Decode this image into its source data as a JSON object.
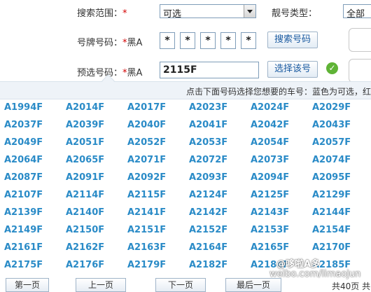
{
  "search": {
    "range_label": "搜索范围：",
    "required_mark": "*",
    "range_value": "可选",
    "type_label": "靓号类型：",
    "type_value": "全部"
  },
  "plate": {
    "label": "号牌号码：",
    "required_mark": "*",
    "prefix": "黑A",
    "chars": [
      "*",
      "*",
      "*",
      "*",
      "*"
    ],
    "search_button": "搜索号码"
  },
  "preselect": {
    "label": "预选号码：",
    "required_mark": "*",
    "prefix": "黑A",
    "value": "2115F",
    "select_button": "选择该号"
  },
  "hint": "点击下面号码选择您想要的车号：蓝色为可选，红",
  "numbers": [
    [
      "A1994F",
      "A2014F",
      "A2017F",
      "A2023F",
      "A2024F",
      "A2029F"
    ],
    [
      "A2037F",
      "A2039F",
      "A2040F",
      "A2041F",
      "A2042F",
      "A2043F"
    ],
    [
      "A2049F",
      "A2051F",
      "A2052F",
      "A2053F",
      "A2054F",
      "A2057F"
    ],
    [
      "A2064F",
      "A2065F",
      "A2071F",
      "A2072F",
      "A2073F",
      "A2074F"
    ],
    [
      "A2087F",
      "A2091F",
      "A2092F",
      "A2093F",
      "A2094F",
      "A2095F"
    ],
    [
      "A2107F",
      "A2114F",
      "A2115F",
      "A2124F",
      "A2125F",
      "A2129F"
    ],
    [
      "A2139F",
      "A2140F",
      "A2141F",
      "A2142F",
      "A2143F",
      "A2144F"
    ],
    [
      "A2149F",
      "A2150F",
      "A2151F",
      "A2152F",
      "A2153F",
      "A2154F"
    ],
    [
      "A2161F",
      "A2162F",
      "A2163F",
      "A2164F",
      "A2165F",
      "A2170F"
    ],
    [
      "A2175F",
      "A2176F",
      "A2179F",
      "A2182F",
      "A2184F",
      "A2185F"
    ]
  ],
  "pager": {
    "first": "第一页",
    "prev": "上一页",
    "next": "下一页",
    "last": "最后一页",
    "info": "共40页 共"
  },
  "watermark": {
    "user": "@哆啦A多",
    "site": "weibo.com/limaojun"
  },
  "colors": {
    "available": "#2a8bc7",
    "check": "#5fb336"
  }
}
